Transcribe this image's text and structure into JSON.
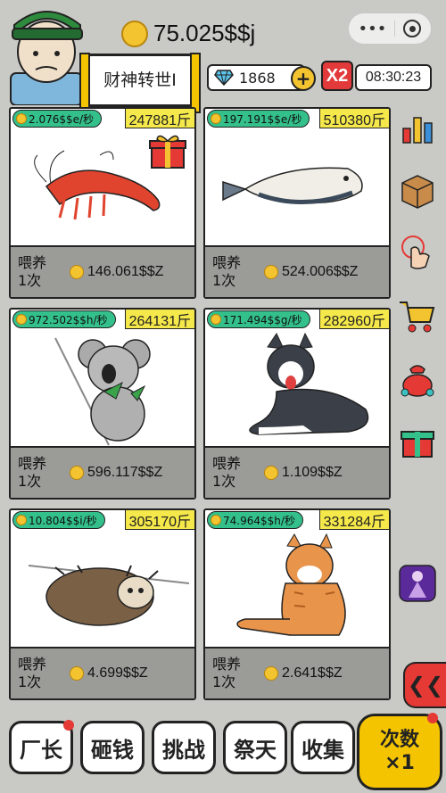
{
  "header": {
    "money": "75.025$$j",
    "title": "财神转世Ⅰ",
    "gems": "1868",
    "multiplier": "X2",
    "timer": "08:30:23"
  },
  "animals": [
    {
      "rate": "2.076$$e/秒",
      "weight": "247881斤",
      "feed_label": "喂养\n1次",
      "cost": "146.061$$Z"
    },
    {
      "rate": "197.191$$e/秒",
      "weight": "510380斤",
      "feed_label": "喂养\n1次",
      "cost": "524.006$$Z"
    },
    {
      "rate": "972.502$$h/秒",
      "weight": "264131斤",
      "feed_label": "喂养\n1次",
      "cost": "596.117$$Z"
    },
    {
      "rate": "171.494$$g/秒",
      "weight": "282960斤",
      "feed_label": "喂养\n1次",
      "cost": "1.109$$Z"
    },
    {
      "rate": "10.804$$i/秒",
      "weight": "305170斤",
      "feed_label": "喂养\n1次",
      "cost": "4.699$$Z"
    },
    {
      "rate": "74.964$$h/秒",
      "weight": "331284斤",
      "feed_label": "喂养\n1次",
      "cost": "2.641$$Z"
    }
  ],
  "bottom": {
    "btn1": "厂长",
    "btn2": "砸钱",
    "btn3": "挑战",
    "btn4": "祭天",
    "btn5": "收集",
    "big_line1": "次数",
    "big_line2": "×1"
  },
  "colors": {
    "rate_green": "#33c08b",
    "weight_yellow": "#f5e84a",
    "footer_gray": "#9b9b98",
    "accent_red": "#e53935",
    "gold": "#f4c430"
  }
}
